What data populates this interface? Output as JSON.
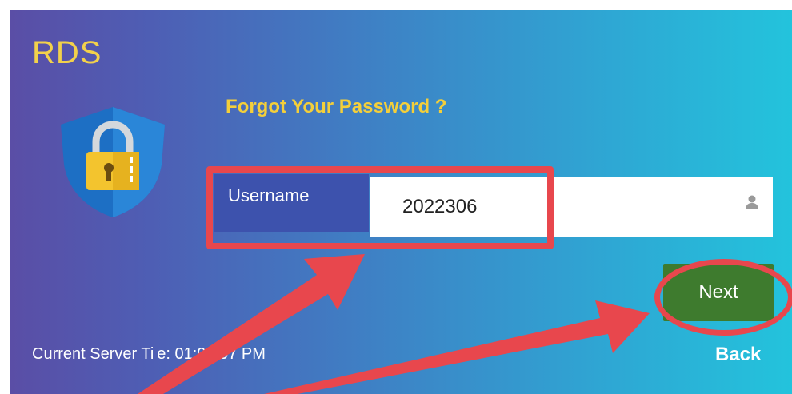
{
  "app": {
    "brand": "RDS"
  },
  "form": {
    "title": "Forgot Your Password ?",
    "username_label": "Username",
    "username_value": "2022306",
    "next_label": "Next",
    "back_label": "Back"
  },
  "footer": {
    "server_time_label": "Current Server Ti",
    "server_time_value": "e: 01:03:07 PM"
  },
  "icons": {
    "shield": "shield-lock-icon",
    "user": "user-icon"
  },
  "colors": {
    "brand_yellow": "#f2d14b",
    "next_green": "#3e7b2e",
    "annotation_red": "#e8474d",
    "label_blue": "#3d52ad"
  }
}
